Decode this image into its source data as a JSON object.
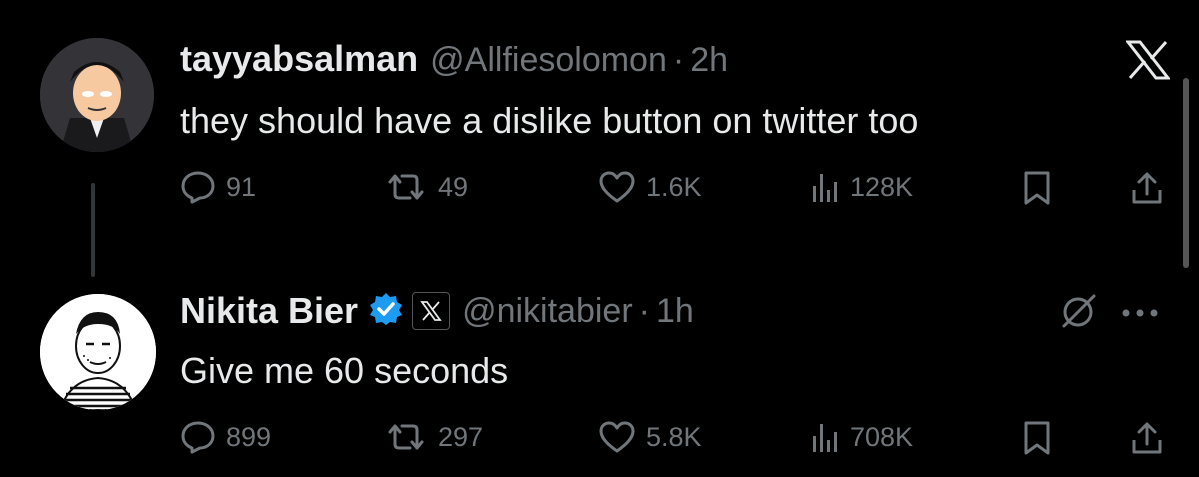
{
  "tweet1": {
    "name": "tayyabsalman",
    "handle": "@Allfiesolomon",
    "time": "2h",
    "text": "they should have a dislike button on twitter too",
    "replies": "91",
    "reposts": "49",
    "likes": "1.6K",
    "views": "128K"
  },
  "tweet2": {
    "name": "Nikita Bier",
    "handle": "@nikitabier",
    "time": "1h",
    "text": "Give me 60 seconds",
    "replies": "899",
    "reposts": "297",
    "likes": "5.8K",
    "views": "708K"
  },
  "separator": "·",
  "colors": {
    "background": "#000000",
    "text": "#e7e9ea",
    "muted": "#71767b",
    "verified": "#1d9bf0"
  }
}
